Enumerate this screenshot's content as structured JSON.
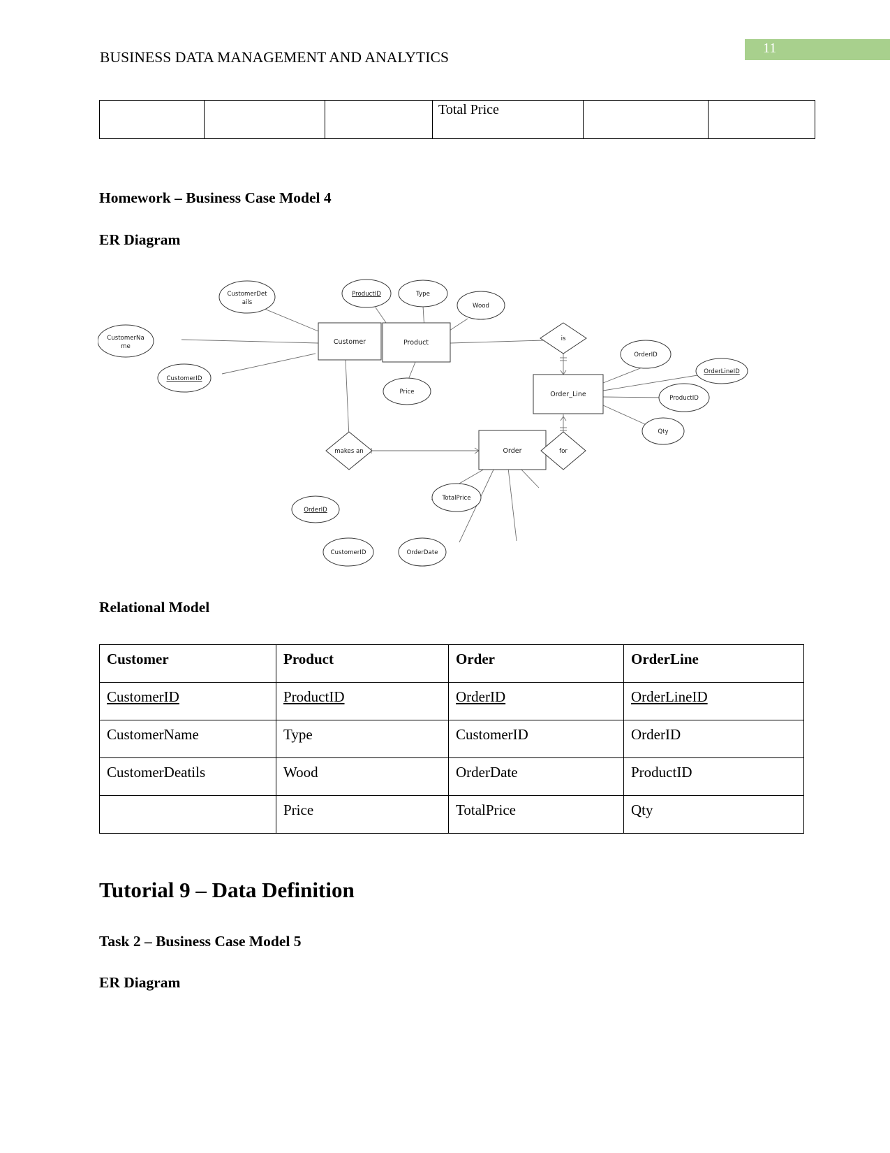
{
  "header": {
    "running_title": "BUSINESS DATA MANAGEMENT AND ANALYTICS",
    "page_number": "11"
  },
  "stub_table": {
    "cells": [
      "",
      "",
      "",
      "Total Price",
      "",
      ""
    ]
  },
  "headings": {
    "homework": "Homework – Business Case Model 4",
    "er_diagram_1": "ER Diagram",
    "relational_model": "Relational Model",
    "tutorial": "Tutorial 9 – Data Definition",
    "task": "Task 2 – Business Case Model 5",
    "er_diagram_2": "ER Diagram"
  },
  "er_diagram": {
    "entities": [
      {
        "id": "customer",
        "label": "Customer"
      },
      {
        "id": "product",
        "label": "Product"
      },
      {
        "id": "order_line",
        "label": "Order_Line"
      },
      {
        "id": "order",
        "label": "Order"
      }
    ],
    "relationships": [
      {
        "id": "is",
        "label": "is"
      },
      {
        "id": "makes_an",
        "label": "makes an"
      },
      {
        "id": "for",
        "label": "for"
      }
    ],
    "attributes": [
      {
        "id": "customer-details",
        "label_line1": "CustomerDet",
        "label_line2": "ails",
        "primary_key": false,
        "entity": "customer"
      },
      {
        "id": "customer-name",
        "label_line1": "CustomerNa",
        "label_line2": "me",
        "primary_key": false,
        "entity": "customer"
      },
      {
        "id": "customer-id",
        "label_line1": "CustomerID",
        "label_line2": "",
        "primary_key": true,
        "entity": "customer"
      },
      {
        "id": "product-id",
        "label_line1": "ProductID",
        "label_line2": "",
        "primary_key": true,
        "entity": "product"
      },
      {
        "id": "type",
        "label_line1": "Type",
        "label_line2": "",
        "primary_key": false,
        "entity": "product"
      },
      {
        "id": "wood",
        "label_line1": "Wood",
        "label_line2": "",
        "primary_key": false,
        "entity": "product"
      },
      {
        "id": "price",
        "label_line1": "Price",
        "label_line2": "",
        "primary_key": false,
        "entity": "product"
      },
      {
        "id": "ol-order-id",
        "label_line1": "OrderID",
        "label_line2": "",
        "primary_key": false,
        "entity": "order_line"
      },
      {
        "id": "order-line-id",
        "label_line1": "OrderLineID",
        "label_line2": "",
        "primary_key": true,
        "entity": "order_line"
      },
      {
        "id": "ol-product-id",
        "label_line1": "ProductID",
        "label_line2": "",
        "primary_key": false,
        "entity": "order_line"
      },
      {
        "id": "qty",
        "label_line1": "Qty",
        "label_line2": "",
        "primary_key": false,
        "entity": "order_line"
      },
      {
        "id": "o-order-id",
        "label_line1": "OrderID",
        "label_line2": "",
        "primary_key": true,
        "entity": "order"
      },
      {
        "id": "o-customer-id",
        "label_line1": "CustomerID",
        "label_line2": "",
        "primary_key": false,
        "entity": "order"
      },
      {
        "id": "order-date",
        "label_line1": "OrderDate",
        "label_line2": "",
        "primary_key": false,
        "entity": "order"
      },
      {
        "id": "total-price",
        "label_line1": "TotalPrice",
        "label_line2": "",
        "primary_key": false,
        "entity": "order"
      }
    ]
  },
  "relational_table": {
    "headers": [
      "Customer",
      "Product",
      "Order",
      "OrderLine"
    ],
    "rows": [
      {
        "cells": [
          "CustomerID",
          "ProductID",
          "OrderID",
          "OrderLineID"
        ],
        "underline": [
          true,
          true,
          true,
          true
        ]
      },
      {
        "cells": [
          "CustomerName",
          "Type",
          "CustomerID",
          "OrderID"
        ],
        "underline": [
          false,
          false,
          false,
          false
        ]
      },
      {
        "cells": [
          "CustomerDeatils",
          "Wood",
          "OrderDate",
          "ProductID"
        ],
        "underline": [
          false,
          false,
          false,
          false
        ]
      },
      {
        "cells": [
          "",
          "Price",
          "TotalPrice",
          "Qty"
        ],
        "underline": [
          false,
          false,
          false,
          false
        ]
      }
    ]
  },
  "colors": {
    "page_number_badge": "#a8d08d",
    "page_number_text": "#ffffff",
    "table_border": "#000000",
    "diagram_stroke": "#3a3a3a",
    "diagram_line": "#6e6e6e"
  }
}
